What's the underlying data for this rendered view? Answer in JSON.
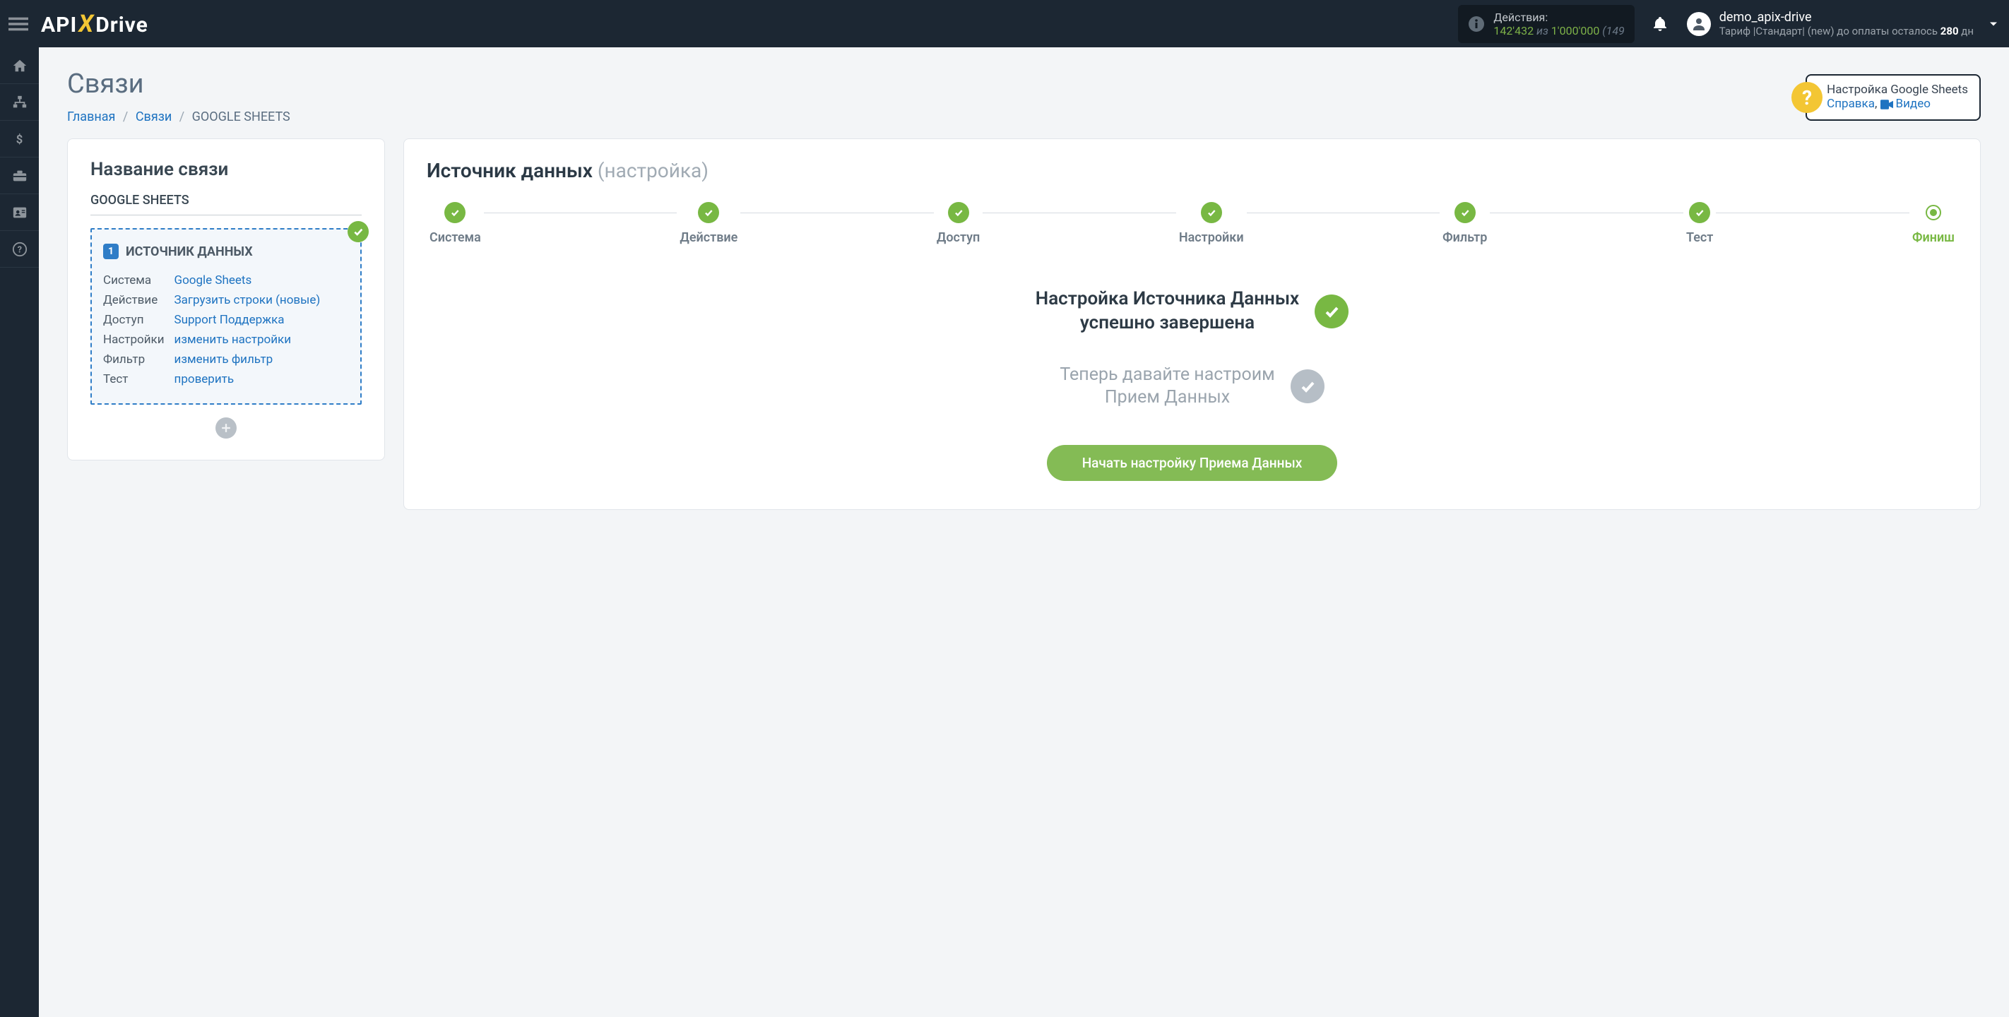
{
  "topbar": {
    "actions_label": "Действия:",
    "actions_used": "142'432",
    "actions_of": "из",
    "actions_total": "1'000'000",
    "actions_trail": "(149",
    "user_name": "demo_apix-drive",
    "tariff_prefix": "Тариф |Стандарт| (new) до оплаты осталось ",
    "tariff_days": "280",
    "tariff_suffix": " дн"
  },
  "page": {
    "title": "Связи",
    "breadcrumb_home": "Главная",
    "breadcrumb_links": "Связи",
    "breadcrumb_current": "GOOGLE SHEETS"
  },
  "help": {
    "title": "Настройка Google Sheets",
    "link1": "Справка",
    "sep": ", ",
    "link2": "Видео"
  },
  "left": {
    "heading": "Название связи",
    "conn_name": "GOOGLE SHEETS",
    "badge": "1",
    "src_title": "ИСТОЧНИК ДАННЫХ",
    "rows": [
      {
        "k": "Система",
        "v": "Google Sheets"
      },
      {
        "k": "Действие",
        "v": "Загрузить строки (новые)"
      },
      {
        "k": "Доступ",
        "v": "Support Поддержка"
      },
      {
        "k": "Настройки",
        "v": "изменить настройки"
      },
      {
        "k": "Фильтр",
        "v": "изменить фильтр"
      },
      {
        "k": "Тест",
        "v": "проверить"
      }
    ]
  },
  "right": {
    "heading_main": "Источник данных",
    "heading_sub": "(настройка)",
    "steps": [
      {
        "label": "Система"
      },
      {
        "label": "Действие"
      },
      {
        "label": "Доступ"
      },
      {
        "label": "Настройки"
      },
      {
        "label": "Фильтр"
      },
      {
        "label": "Тест"
      },
      {
        "label": "Финиш",
        "active": true
      }
    ],
    "status_done_line1": "Настройка Источника Данных",
    "status_done_line2": "успешно завершена",
    "status_pending_line1": "Теперь давайте настроим",
    "status_pending_line2": "Прием Данных",
    "cta": "Начать настройку Приема Данных"
  }
}
